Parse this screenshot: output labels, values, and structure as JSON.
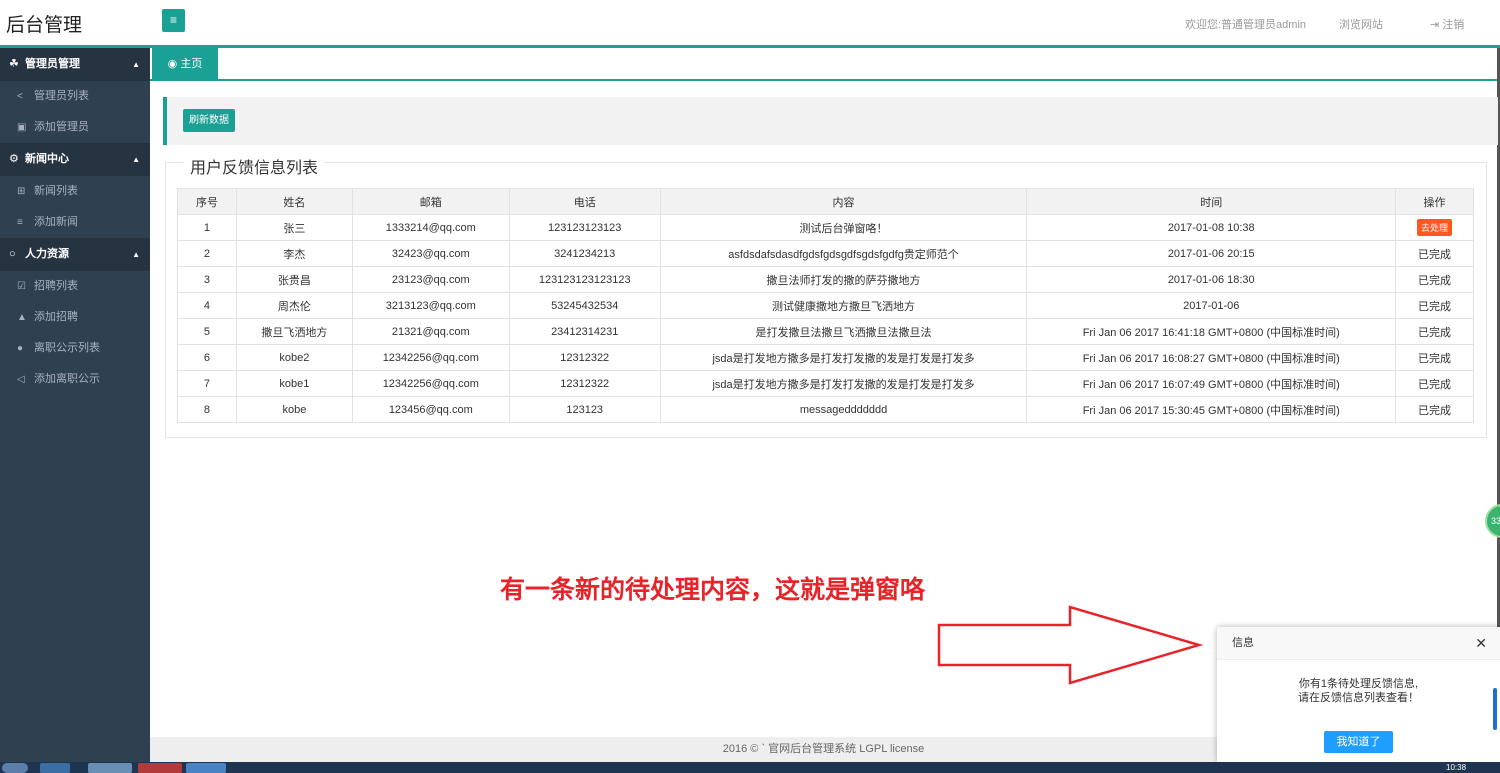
{
  "header": {
    "logo": "后台管理",
    "menu_toggle_icon": "hamburger-icon",
    "welcome": "欢迎您:普通管理员admin",
    "browse": "浏览网站",
    "logout_icon": "logout-icon",
    "logout": "注销"
  },
  "sidebar": {
    "groups": [
      {
        "label": "管理员管理",
        "icon": "users-icon",
        "items": [
          {
            "label": "管理员列表",
            "icon": "share-icon"
          },
          {
            "label": "添加管理员",
            "icon": "card-icon"
          }
        ]
      },
      {
        "label": "新闻中心",
        "icon": "cogs-icon",
        "items": [
          {
            "label": "新闻列表",
            "icon": "grid-icon"
          },
          {
            "label": "添加新闻",
            "icon": "list-icon"
          }
        ]
      },
      {
        "label": "人力资源",
        "icon": "circle-icon",
        "items": [
          {
            "label": "招聘列表",
            "icon": "check-square-icon"
          },
          {
            "label": "添加招聘",
            "icon": "bell-icon"
          },
          {
            "label": "离职公示列表",
            "icon": "github-icon"
          },
          {
            "label": "添加离职公示",
            "icon": "send-icon"
          }
        ]
      }
    ]
  },
  "tabs": {
    "home": "主页",
    "home_icon": "dashboard-icon"
  },
  "toolbar": {
    "refresh": "刷新数据"
  },
  "feedback": {
    "title": "用户反馈信息列表",
    "columns": [
      "序号",
      "姓名",
      "邮箱",
      "电话",
      "内容",
      "时间",
      "操作"
    ],
    "rows": [
      [
        "1",
        "张三",
        "1333214@qq.com",
        "123123123123",
        "测试后台弹窗咯！",
        "2017-01-08 10:38",
        "去处理"
      ],
      [
        "2",
        "李杰",
        "32423@qq.com",
        "3241234213",
        "asfdsdafsdasdfgdsfgdsgdfsgdsfgdfg贵定师范个",
        "2017-01-06 20:15",
        "已完成"
      ],
      [
        "3",
        "张贵昌",
        "23123@qq.com",
        "123123123123123",
        "撒旦法师打发的撒的萨芬撒地方",
        "2017-01-06 18:30",
        "已完成"
      ],
      [
        "4",
        "周杰伦",
        "3213123@qq.com",
        "53245432534",
        "测试健康撒地方撒旦飞洒地方",
        "2017-01-06",
        "已完成"
      ],
      [
        "5",
        "撒旦飞洒地方",
        "21321@qq.com",
        "23412314231",
        "是打发撒旦法撒旦飞洒撒旦法撒旦法",
        "Fri Jan 06 2017 16:41:18 GMT+0800 (中国标准时间)",
        "已完成"
      ],
      [
        "6",
        "kobe2",
        "12342256@qq.com",
        "12312322",
        "jsda是打发地方撒多是打发打发撒的发是打发是打发多",
        "Fri Jan 06 2017 16:08:27 GMT+0800 (中国标准时间)",
        "已完成"
      ],
      [
        "7",
        "kobe1",
        "12342256@qq.com",
        "12312322",
        "jsda是打发地方撒多是打发打发撒的发是打发是打发多",
        "Fri Jan 06 2017 16:07:49 GMT+0800 (中国标准时间)",
        "已完成"
      ],
      [
        "8",
        "kobe",
        "123456@qq.com",
        "123123",
        "messageddddddd",
        "Fri Jan 06 2017 15:30:45 GMT+0800 (中国标准时间)",
        "已完成"
      ]
    ]
  },
  "annotation": {
    "text": "有一条新的待处理内容，这就是弹窗咯",
    "color": "#e8232a"
  },
  "footer": {
    "text": "2016 © ` 官网后台管理系统  LGPL license"
  },
  "float_badge": "33",
  "popup": {
    "title": "信息",
    "close": "✕",
    "line1": "你有1条待处理反馈信息,",
    "line2": "请在反馈信息列表查看！",
    "button": "我知道了"
  },
  "taskbar": {
    "clock": "10:38"
  },
  "colors": {
    "accent": "#1aa094",
    "sidebar": "#2f4050",
    "danger": "#ff5722",
    "popup_button": "#1e9fff"
  }
}
